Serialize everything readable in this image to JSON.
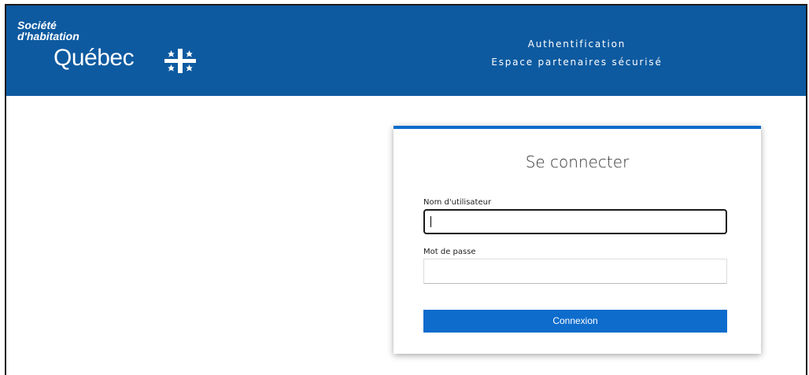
{
  "header": {
    "logo": {
      "line1": "Société",
      "line2": "d'habitation",
      "name": "Québec"
    },
    "title": "Authentification",
    "subtitle": "Espace partenaires sécurisé",
    "background_color": "#0d5aa0"
  },
  "login": {
    "title": "Se connecter",
    "username_label": "Nom d'utilisateur",
    "username_value": "",
    "password_label": "Mot de passe",
    "password_value": "",
    "submit_label": "Connexion",
    "accent_color": "#0d6ccc"
  },
  "icons": {
    "flag": "quebec-flag-icon"
  }
}
